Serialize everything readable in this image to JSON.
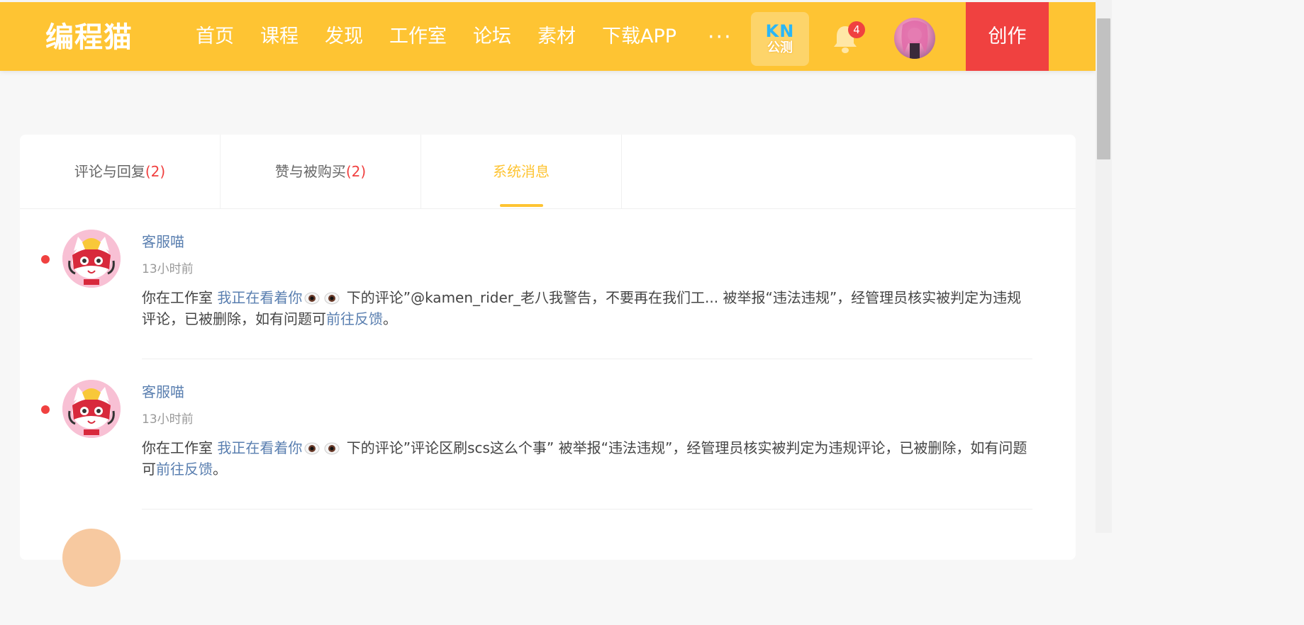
{
  "header": {
    "logo": "编程猫",
    "nav": [
      "首页",
      "课程",
      "发现",
      "工作室",
      "论坛",
      "素材",
      "下载APP"
    ],
    "more": "···",
    "kn_badge": {
      "top": "KN",
      "bottom": "公测"
    },
    "notification_count": "4",
    "create_label": "创作"
  },
  "tabs": [
    {
      "label": "评论与回复",
      "count": "(2)"
    },
    {
      "label": "赞与被购买",
      "count": "(2)"
    },
    {
      "label": "系统消息",
      "count": ""
    }
  ],
  "messages": [
    {
      "sender": "客服喵",
      "time": "13小时前",
      "prefix": "你在工作室 ",
      "studio_link": "我正在看着你",
      "middle": " 下的评论”@kamen_rider_老八我警告，不要再在我们工... 被举报“违法违规”，经管理员核实被判定为违规评论，已被删除，如有问题可",
      "feedback_link": "前往反馈",
      "suffix": "。"
    },
    {
      "sender": "客服喵",
      "time": "13小时前",
      "prefix": "你在工作室 ",
      "studio_link": "我正在看着你",
      "middle": " 下的评论”评论区刷scs这么个事” 被举报“违法违规”，经管理员核实被判定为违规评论，已被删除，如有问题可",
      "feedback_link": "前往反馈",
      "suffix": "。"
    }
  ],
  "colors": {
    "brand": "#fec433",
    "create": "#f04140",
    "link": "#5a7fb0",
    "unread": "#f04140"
  }
}
